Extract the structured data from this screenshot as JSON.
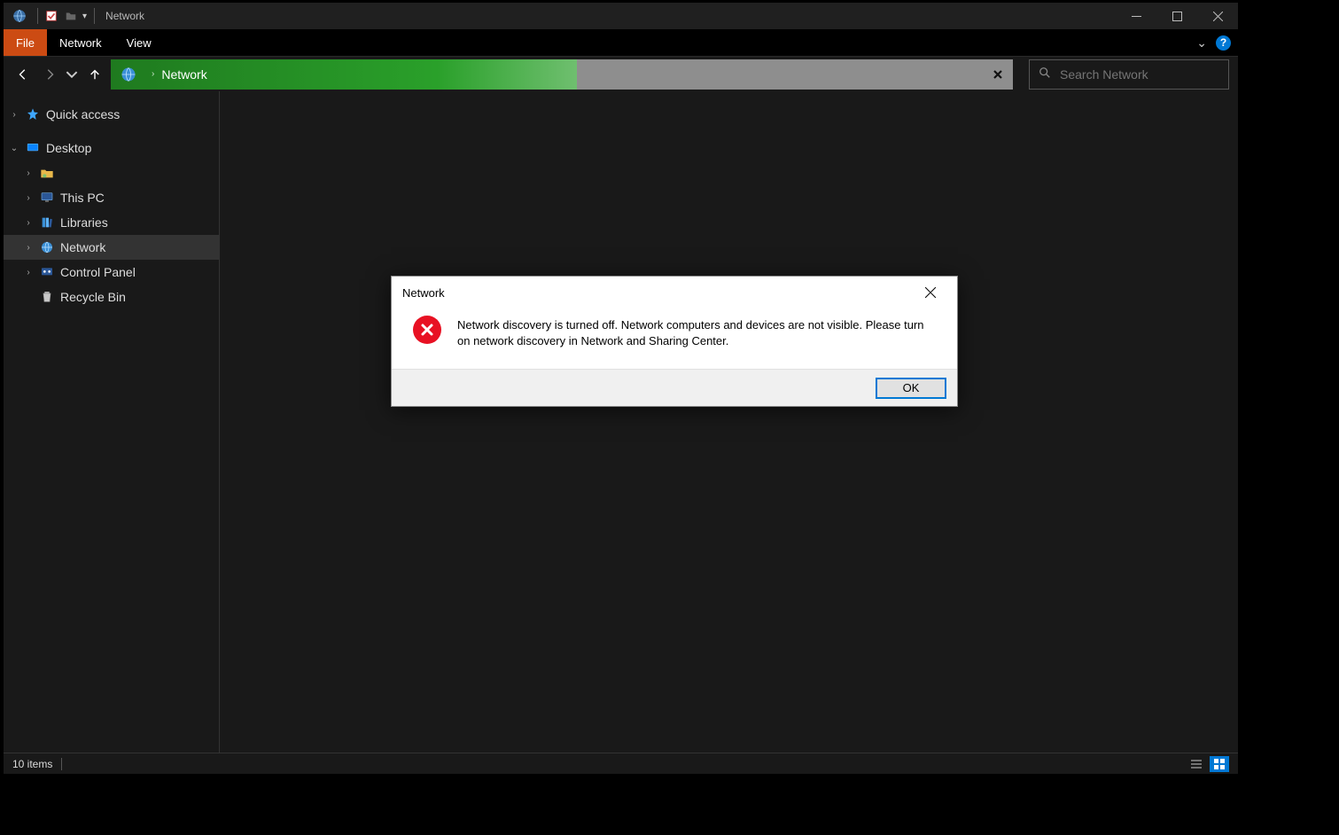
{
  "window": {
    "title": "Network"
  },
  "ribbon": {
    "file": "File",
    "tabs": [
      "Network",
      "View"
    ]
  },
  "nav": {
    "address_label": "Network",
    "search_placeholder": "Search Network"
  },
  "sidebar": {
    "quick_access": "Quick access",
    "desktop": "Desktop",
    "children": [
      {
        "label": ""
      },
      {
        "label": "This PC"
      },
      {
        "label": "Libraries"
      },
      {
        "label": "Network"
      },
      {
        "label": "Control Panel"
      },
      {
        "label": "Recycle Bin"
      }
    ]
  },
  "dialog": {
    "title": "Network",
    "message": "Network discovery is turned off. Network computers and devices are not visible. Please turn on network discovery in Network and Sharing Center.",
    "ok": "OK"
  },
  "status": {
    "items": "10 items"
  }
}
